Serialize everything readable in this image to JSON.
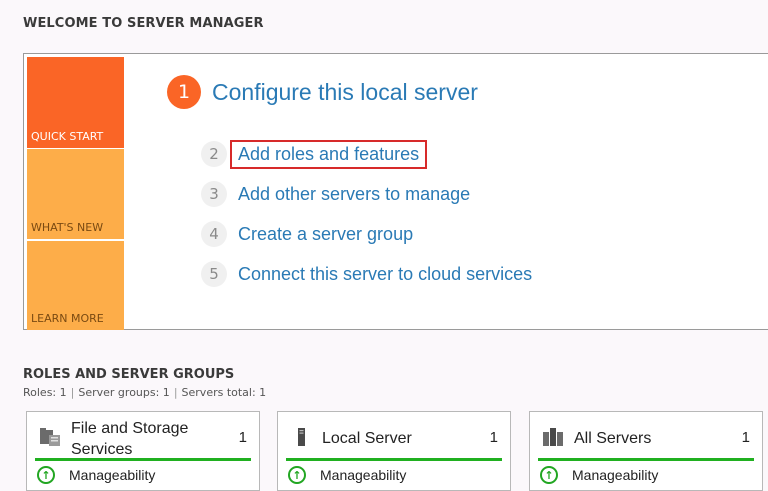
{
  "welcome": {
    "title": "WELCOME TO SERVER MANAGER",
    "tiles": [
      "QUICK START",
      "WHAT'S NEW",
      "LEARN MORE"
    ],
    "step1": {
      "number": "1",
      "label": "Configure this local server"
    },
    "steps": [
      {
        "number": "2",
        "label": "Add roles and features",
        "highlighted": true
      },
      {
        "number": "3",
        "label": "Add other servers to manage"
      },
      {
        "number": "4",
        "label": "Create a server group"
      },
      {
        "number": "5",
        "label": "Connect this server to cloud services"
      }
    ]
  },
  "roles": {
    "title": "ROLES AND SERVER GROUPS",
    "summary": {
      "roles": "Roles: 1",
      "server_groups": "Server groups: 1",
      "servers_total": "Servers total: 1",
      "separator": "|"
    },
    "cards": [
      {
        "name_line1": "File and Storage",
        "name_line2": "Services",
        "count": "1",
        "status": "Manageability",
        "icon": "file-storage-icon"
      },
      {
        "name_line1": "Local Server",
        "name_line2": "",
        "count": "1",
        "status": "Manageability",
        "icon": "local-server-icon"
      },
      {
        "name_line1": "All Servers",
        "name_line2": "",
        "count": "1",
        "status": "Manageability",
        "icon": "all-servers-icon"
      }
    ]
  },
  "colors": {
    "quick_start": "#fa6526",
    "whats_new": "#fdad49",
    "link": "#2a7ab5",
    "highlight_border": "#d72a2a",
    "status_green": "#20b020"
  }
}
